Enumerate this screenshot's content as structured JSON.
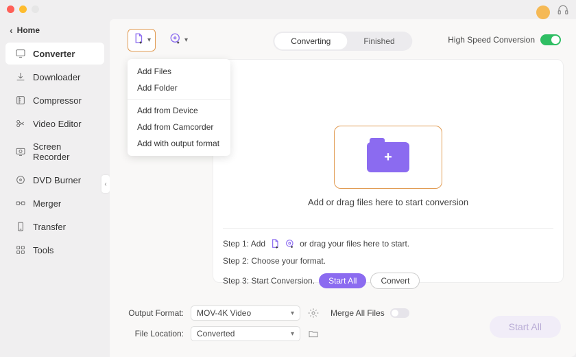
{
  "home_label": "Home",
  "sidebar": {
    "items": [
      {
        "label": "Converter",
        "icon": "converter-icon"
      },
      {
        "label": "Downloader",
        "icon": "downloader-icon"
      },
      {
        "label": "Compressor",
        "icon": "compressor-icon"
      },
      {
        "label": "Video Editor",
        "icon": "video-editor-icon"
      },
      {
        "label": "Screen Recorder",
        "icon": "screen-recorder-icon"
      },
      {
        "label": "DVD Burner",
        "icon": "dvd-burner-icon"
      },
      {
        "label": "Merger",
        "icon": "merger-icon"
      },
      {
        "label": "Transfer",
        "icon": "transfer-icon"
      },
      {
        "label": "Tools",
        "icon": "tools-icon"
      }
    ],
    "active_index": 0
  },
  "dropdown": {
    "group1": [
      "Add Files",
      "Add Folder"
    ],
    "group2": [
      "Add from Device",
      "Add from Camcorder",
      "Add with output format"
    ]
  },
  "tabs": {
    "items": [
      "Converting",
      "Finished"
    ],
    "active_index": 0
  },
  "high_speed": {
    "label": "High Speed Conversion",
    "on": true
  },
  "drop_caption": "Add or drag files here to start conversion",
  "steps": {
    "s1_prefix": "Step 1: Add",
    "s1_suffix": "or drag your files here to start.",
    "s2": "Step 2: Choose your format.",
    "s3": "Step 3: Start Conversion.",
    "start_all_label": "Start  All",
    "convert_label": "Convert"
  },
  "footer": {
    "output_format_label": "Output Format:",
    "output_format_value": "MOV-4K Video",
    "file_location_label": "File Location:",
    "file_location_value": "Converted",
    "merge_label": "Merge All Files"
  },
  "main_start_all": "Start All",
  "colors": {
    "accent": "#8b6bf0",
    "orange": "#e19b52",
    "switch_on": "#2fbe63"
  }
}
